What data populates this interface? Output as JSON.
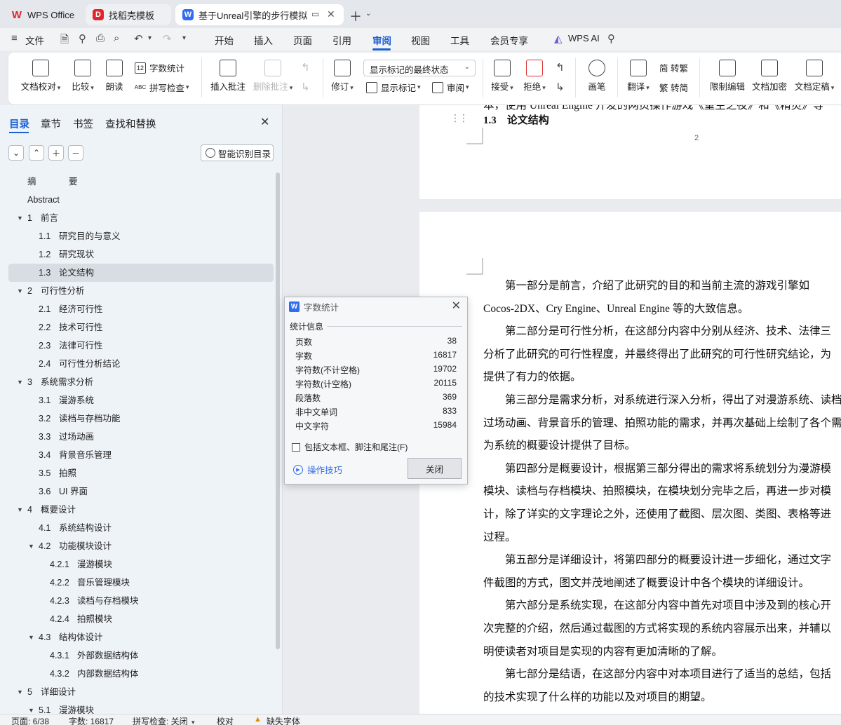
{
  "tabs": [
    {
      "label": "WPS Office"
    },
    {
      "label": "找稻壳模板"
    },
    {
      "label": "基于Unreal引擎的步行模拟器"
    }
  ],
  "menu": {
    "file": "文件",
    "items": [
      "开始",
      "插入",
      "页面",
      "引用",
      "审阅",
      "视图",
      "工具",
      "会员专享"
    ],
    "ai": "WPS AI"
  },
  "ribbon": {
    "proofread": "文档校对",
    "compare": "比较",
    "read_aloud": "朗读",
    "word_count": "字数统计",
    "spell_check": "拼写检查",
    "insert_comment": "插入批注",
    "delete_comment": "删除批注",
    "revise": "修订",
    "markup_state": "显示标记的最终状态",
    "show_markup": "显示标记",
    "review_pane": "审阅",
    "accept": "接受",
    "reject": "拒绝",
    "pen": "画笔",
    "translate": "翻译",
    "to_traditional": "简 转繁",
    "to_simplified": "繁 转简",
    "restrict_edit": "限制编辑",
    "encrypt": "文档加密",
    "finalize": "文档定稿"
  },
  "sidebar": {
    "tabs": [
      "目录",
      "章节",
      "书签",
      "查找和替换"
    ],
    "smart_toc": "智能识别目录",
    "toc": [
      {
        "num": "摘",
        "title": "要",
        "level": 0,
        "expand": ""
      },
      {
        "num": "Abstract",
        "title": "",
        "level": 0,
        "expand": ""
      },
      {
        "num": "1",
        "title": "前言",
        "level": 0,
        "expand": "▼"
      },
      {
        "num": "1.1",
        "title": "研究目的与意义",
        "level": 1,
        "expand": ""
      },
      {
        "num": "1.2",
        "title": "研究现状",
        "level": 1,
        "expand": ""
      },
      {
        "num": "1.3",
        "title": "论文结构",
        "level": 1,
        "expand": "",
        "selected": true
      },
      {
        "num": "2",
        "title": "可行性分析",
        "level": 0,
        "expand": "▼"
      },
      {
        "num": "2.1",
        "title": "经济可行性",
        "level": 1,
        "expand": ""
      },
      {
        "num": "2.2",
        "title": "技术可行性",
        "level": 1,
        "expand": ""
      },
      {
        "num": "2.3",
        "title": "法律可行性",
        "level": 1,
        "expand": ""
      },
      {
        "num": "2.4",
        "title": "可行性分析结论",
        "level": 1,
        "expand": ""
      },
      {
        "num": "3",
        "title": "系统需求分析",
        "level": 0,
        "expand": "▼"
      },
      {
        "num": "3.1",
        "title": "漫游系统",
        "level": 1,
        "expand": ""
      },
      {
        "num": "3.2",
        "title": "读档与存档功能",
        "level": 1,
        "expand": ""
      },
      {
        "num": "3.3",
        "title": "过场动画",
        "level": 1,
        "expand": ""
      },
      {
        "num": "3.4",
        "title": "背景音乐管理",
        "level": 1,
        "expand": ""
      },
      {
        "num": "3.5",
        "title": "拍照",
        "level": 1,
        "expand": ""
      },
      {
        "num": "3.6",
        "title": "UI 界面",
        "level": 1,
        "expand": ""
      },
      {
        "num": "4",
        "title": "概要设计",
        "level": 0,
        "expand": "▼"
      },
      {
        "num": "4.1",
        "title": "系统结构设计",
        "level": 1,
        "expand": ""
      },
      {
        "num": "4.2",
        "title": "功能模块设计",
        "level": 1,
        "expand": "▼"
      },
      {
        "num": "4.2.1",
        "title": "漫游模块",
        "level": 2,
        "expand": ""
      },
      {
        "num": "4.2.2",
        "title": "音乐管理模块",
        "level": 2,
        "expand": ""
      },
      {
        "num": "4.2.3",
        "title": "读档与存档模块",
        "level": 2,
        "expand": ""
      },
      {
        "num": "4.2.4",
        "title": "拍照模块",
        "level": 2,
        "expand": ""
      },
      {
        "num": "4.3",
        "title": "结构体设计",
        "level": 1,
        "expand": "▼"
      },
      {
        "num": "4.3.1",
        "title": "外部数据结构体",
        "level": 2,
        "expand": ""
      },
      {
        "num": "4.3.2",
        "title": "内部数据结构体",
        "level": 2,
        "expand": ""
      },
      {
        "num": "5",
        "title": "详细设计",
        "level": 0,
        "expand": "▼"
      },
      {
        "num": "5.1",
        "title": "漫游模块",
        "level": 1,
        "expand": "▼"
      }
    ]
  },
  "document": {
    "top_line": "本，使用 Unreal Engine 开发的网页操作游戏《重生之夜》和《精灵》等",
    "heading": "1.3　论文结构",
    "page_number": "2",
    "lines": [
      "　　第一部分是前言，介绍了此研究的目的和当前主流的游戏引擎如",
      "Cocos-2DX、Cry Engine、Unreal Engine 等的大致信息。",
      "　　第二部分是可行性分析，在这部分内容中分别从经济、技术、法律三",
      "分析了此研究的可行性程度，并最终得出了此研究的可行性研究结论，为",
      "提供了有力的依据。",
      "　　第三部分是需求分析，对系统进行深入分析，得出了对漫游系统、读档",
      "过场动画、背景音乐的管理、拍照功能的需求，并再次基础上绘制了各个需",
      "为系统的概要设计提供了目标。",
      "　　第四部分是概要设计，根据第三部分得出的需求将系统划分为漫游模",
      "模块、读档与存档模块、拍照模块，在模块划分完毕之后，再进一步对模",
      "计，除了详实的文字理论之外，还使用了截图、层次图、类图、表格等进",
      "过程。",
      "　　第五部分是详细设计，将第四部分的概要设计进一步细化，通过文字",
      "件截图的方式，图文并茂地阐述了概要设计中各个模块的详细设计。",
      "　　第六部分是系统实现，在这部分内容中首先对项目中涉及到的核心开",
      "次完整的介绍，然后通过截图的方式将实现的系统内容展示出来，并辅以",
      "明使读者对项目是实现的内容有更加清晰的了解。",
      "　　第七部分是结语，在这部分内容中对本项目进行了适当的总结，包括",
      "的技术实现了什么样的功能以及对项目的期望。"
    ]
  },
  "word_count_dialog": {
    "title": "字数统计",
    "group": "统计信息",
    "rows": [
      {
        "label": "页数",
        "value": "38"
      },
      {
        "label": "字数",
        "value": "16817"
      },
      {
        "label": "字符数(不计空格)",
        "value": "19702"
      },
      {
        "label": "字符数(计空格)",
        "value": "20115"
      },
      {
        "label": "段落数",
        "value": "369"
      },
      {
        "label": "非中文单词",
        "value": "833"
      },
      {
        "label": "中文字符",
        "value": "15984"
      }
    ],
    "include_label": "包括文本框、脚注和尾注(F)",
    "tips": "操作技巧",
    "close": "关闭"
  },
  "status": {
    "page": "页面: 6/38",
    "words": "字数: 16817",
    "spell": "拼写检查: 关闭",
    "proof": "校对",
    "missing_font": "缺失字体"
  }
}
